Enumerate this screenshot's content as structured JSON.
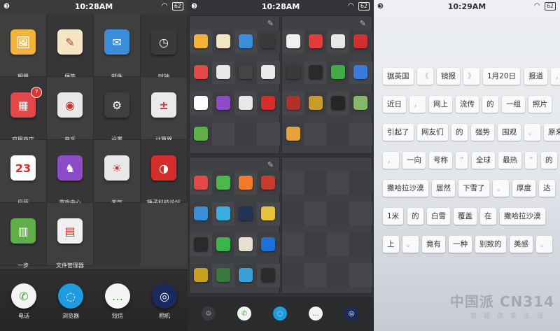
{
  "panel1": {
    "status": {
      "left": "❸",
      "time": "10:28AM",
      "battery": "62"
    },
    "apps": [
      {
        "label": "相册",
        "icon": "photo-album-icon",
        "glyph": "🖼",
        "bg": "#f3b23a"
      },
      {
        "label": "便签",
        "icon": "notepad-icon",
        "glyph": "✎",
        "bg": "#f4e6c4"
      },
      {
        "label": "邮件",
        "icon": "mail-stamp-icon",
        "glyph": "✉",
        "bg": "#3a8ed9"
      },
      {
        "label": "时钟",
        "icon": "clock-icon",
        "glyph": "◷",
        "bg": "#3a3a3a"
      },
      {
        "label": "应用商店",
        "icon": "app-store-icon",
        "glyph": "▦",
        "bg": "#e24848",
        "badge": "7"
      },
      {
        "label": "音乐",
        "icon": "record-player-icon",
        "glyph": "◉",
        "bg": "#e9e9e9"
      },
      {
        "label": "设置",
        "icon": "gear-icon",
        "glyph": "⚙",
        "bg": "#3f3f3f"
      },
      {
        "label": "计算器",
        "icon": "calculator-icon",
        "glyph": "±",
        "bg": "#eaeaea"
      },
      {
        "label": "日历",
        "icon": "calendar-icon",
        "glyph": "23",
        "bg": "#ffffff"
      },
      {
        "label": "游戏中心",
        "icon": "game-center-icon",
        "glyph": "♞",
        "bg": "#8e4bc7"
      },
      {
        "label": "天气",
        "icon": "weather-icon",
        "glyph": "☀",
        "bg": "#e8e8e8"
      },
      {
        "label": "锤子科技论坛",
        "icon": "forum-icon",
        "glyph": "◑",
        "bg": "#d72c2c"
      },
      {
        "label": "一步",
        "icon": "one-step-icon",
        "glyph": "▥",
        "bg": "#5fae47"
      },
      {
        "label": "文件管理器",
        "icon": "file-manager-icon",
        "glyph": "▤",
        "bg": "#f0f0f0"
      }
    ],
    "dock": [
      {
        "label": "电话",
        "icon": "phone-icon",
        "glyph": "✆",
        "bg": "#f4f4f4"
      },
      {
        "label": "浏览器",
        "icon": "browser-icon",
        "glyph": "◌",
        "bg": "#1f9be0"
      },
      {
        "label": "短信",
        "icon": "messages-icon",
        "glyph": "…",
        "bg": "#f4f4f4"
      },
      {
        "label": "相机",
        "icon": "camera-icon",
        "glyph": "◎",
        "bg": "#1a2a5e"
      }
    ]
  },
  "panel2": {
    "status": {
      "left": "❸",
      "time": "10:28AM",
      "battery": "62"
    },
    "dock": [
      {
        "icon": "settings-icon",
        "glyph": "⚙"
      },
      {
        "icon": "phone-icon",
        "glyph": "✆"
      },
      {
        "icon": "browser-icon",
        "glyph": "◌"
      },
      {
        "icon": "messages-icon",
        "glyph": "…"
      },
      {
        "icon": "camera-icon",
        "glyph": "◎"
      }
    ]
  },
  "panel3": {
    "status": {
      "left": "❸",
      "time": "10:29AM",
      "battery": "62"
    },
    "rows": [
      [
        "据英国",
        "《",
        "镜报",
        "》",
        "1月20日",
        "报道",
        "，"
      ],
      [
        "近日",
        "，",
        "网上",
        "流传",
        "的",
        "一组",
        "照片"
      ],
      [
        "引起了",
        "网友们",
        "的",
        "强势",
        "围观",
        "。",
        "原来"
      ],
      [
        "，",
        "一向",
        "号称",
        "“",
        "全球",
        "最热",
        "”",
        "的"
      ],
      [
        "撒哈拉沙漠",
        "居然",
        "下雪了",
        "。",
        "厚度",
        "达"
      ],
      [
        "1米",
        "的",
        "白雪",
        "覆盖",
        "在",
        "撒哈拉沙漠"
      ],
      [
        "上",
        "。",
        "竟有",
        "一种",
        "别致的",
        "美感",
        "。"
      ]
    ],
    "watermark": "中国派 CN314",
    "watermark_sub": "智能改变生活"
  }
}
